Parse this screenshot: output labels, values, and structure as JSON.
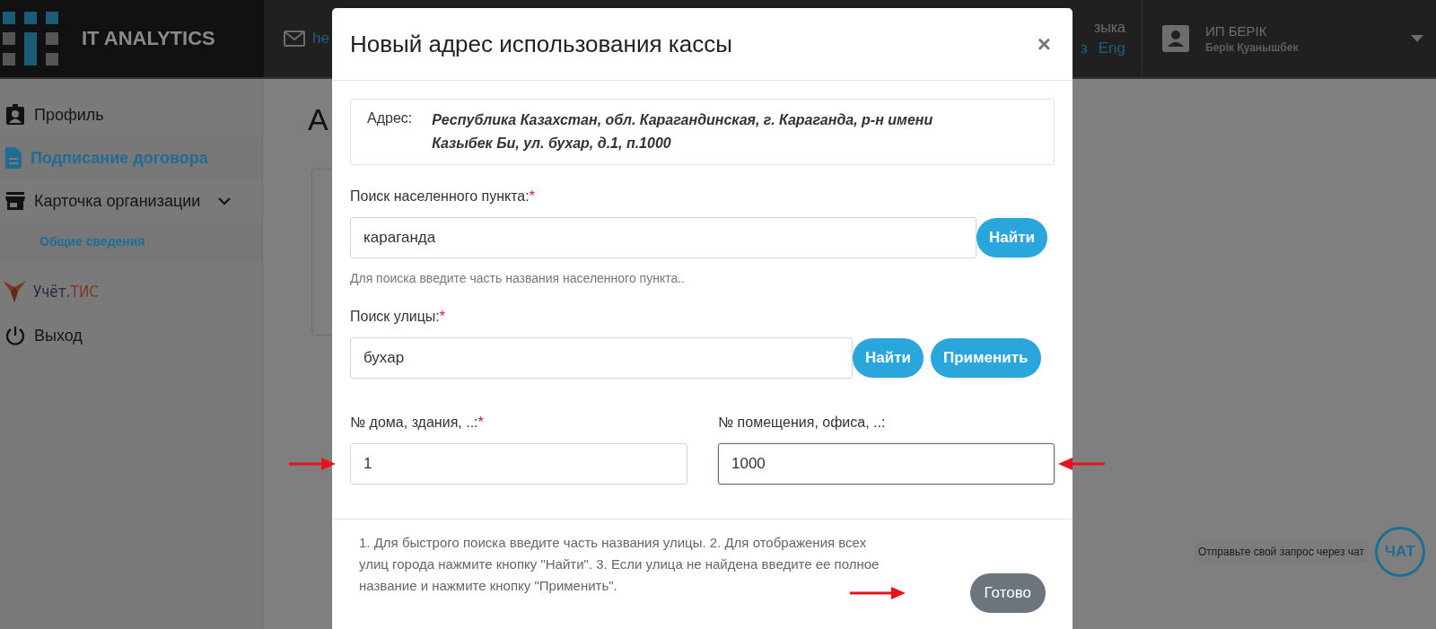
{
  "header": {
    "logo_text": "IT ANALYTICS",
    "email_partial": "he",
    "lang_title_partial": "зыка",
    "languages": [
      {
        "label": "з",
        "selected": false
      },
      {
        "label": "Eng",
        "selected": false
      }
    ],
    "user": {
      "org": "ИП БЕРІК",
      "name": "Берік Қуанышбек"
    }
  },
  "sidebar": {
    "items": [
      {
        "label": "Профиль",
        "selected": false
      },
      {
        "label": "Подписание договора",
        "selected": true
      },
      {
        "label": "Карточка организации",
        "selected": false,
        "expanded": true,
        "children": [
          {
            "label": "Общие сведения",
            "selected": true
          }
        ]
      }
    ],
    "brand": {
      "part1": "Учёт.",
      "part2": "ТИС"
    },
    "logout": "Выход"
  },
  "page": {
    "title_partial": "А"
  },
  "chat": {
    "prompt": "Отправьте свой запрос через чат",
    "button": "ЧАТ"
  },
  "modal": {
    "title": "Новый адрес использования кассы",
    "close": "×",
    "required_mark": "*",
    "address": {
      "label": "Адрес:",
      "value": "Республика Казахстан, обл. Карагандинская, г. Караганда, р-н имени Казыбек Би, ул. бухар, д.1, п.1000"
    },
    "locality": {
      "label": "Поиск населенного пункта:",
      "required": true,
      "value": "караганда",
      "buttons": [
        "Найти"
      ],
      "hint": "Для поиска введите часть названия населенного пункта.."
    },
    "street": {
      "label": "Поиск улицы:",
      "required": true,
      "value": "бухар",
      "buttons": [
        "Найти",
        "Применить"
      ]
    },
    "house": {
      "label": "№ дома, здания, ..:",
      "required": true,
      "value": "1",
      "focused": false
    },
    "office": {
      "label": "№ помещения, офиса, ..:",
      "required": false,
      "value": "1000",
      "focused": true
    },
    "help": "1. Для быстрого поиска введите часть названия улицы. 2. Для отображения всех улиц города нажмите кнопку \"Найти\". 3. Если улица не найдена введите ее полное название и нажмите кнопку \"Применить\".",
    "done": "Готово"
  }
}
